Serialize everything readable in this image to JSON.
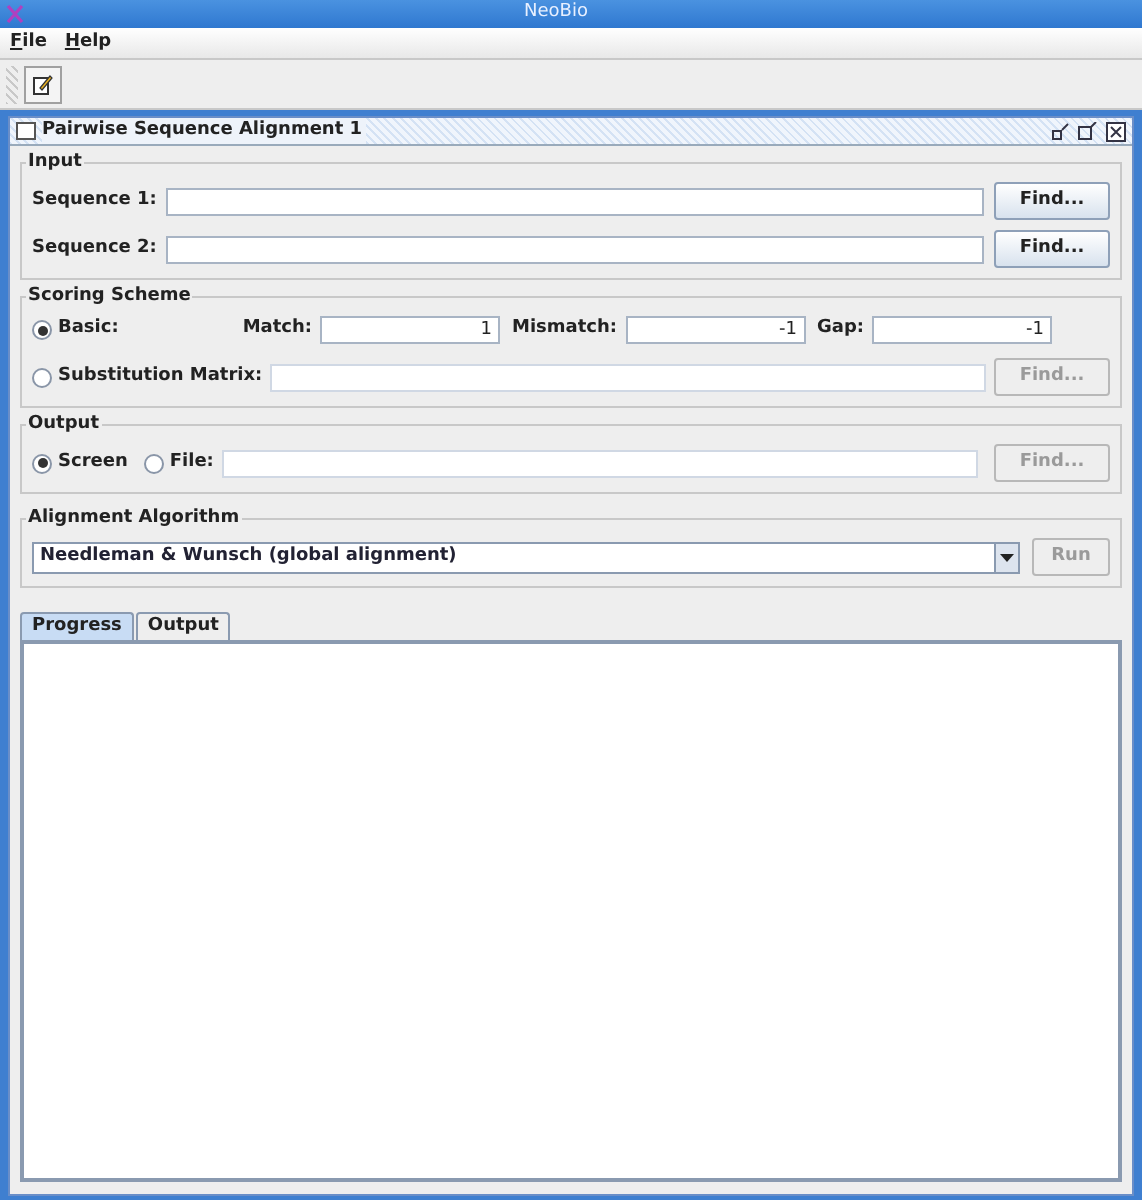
{
  "window": {
    "title": "NeoBio"
  },
  "menu": [
    {
      "label": "File"
    },
    {
      "label": "Help"
    }
  ],
  "internal_frame": {
    "title": "Pairwise Sequence Alignment 1"
  },
  "input": {
    "title": "Input",
    "rows": [
      {
        "label": "Sequence 1:",
        "value": "",
        "button": "Find...",
        "disabled": false
      },
      {
        "label": "Sequence 2:",
        "value": "",
        "button": "Find...",
        "disabled": false
      }
    ]
  },
  "scoring": {
    "title": "Scoring Scheme",
    "options": [
      {
        "label": "Basic:",
        "selected": true
      },
      {
        "label": "Substitution Matrix:",
        "selected": false
      }
    ],
    "fields": [
      {
        "label": "Match:",
        "value": "1"
      },
      {
        "label": "Mismatch:",
        "value": "-1"
      },
      {
        "label": "Gap:",
        "value": "-1"
      }
    ],
    "button": {
      "label": "Find...",
      "disabled": true
    }
  },
  "output": {
    "title": "Output",
    "options": [
      {
        "label": "Screen",
        "selected": true
      },
      {
        "label": "File:",
        "selected": false
      }
    ],
    "button": {
      "label": "Find...",
      "disabled": true
    }
  },
  "algorithm": {
    "title": "Alignment Algorithm",
    "value": "Needleman & Wunsch (global alignment)",
    "button": {
      "label": "Run",
      "disabled": true
    }
  },
  "tabs": [
    {
      "label": "Progress",
      "selected": true
    },
    {
      "label": "Output",
      "selected": false
    }
  ]
}
